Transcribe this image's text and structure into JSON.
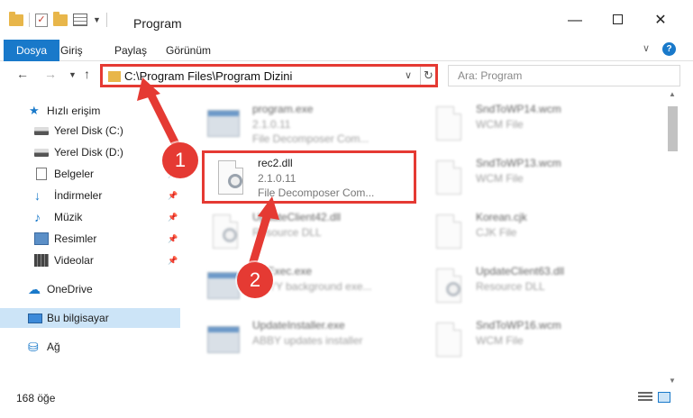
{
  "window": {
    "title": "Program"
  },
  "ribbon": {
    "tabs": [
      {
        "label": "Dosya",
        "active": true
      },
      {
        "label": "Giriş"
      },
      {
        "label": "Paylaş"
      },
      {
        "label": "Görünüm"
      }
    ]
  },
  "address": {
    "path": "C:\\Program Files\\Program Dizini"
  },
  "search": {
    "placeholder": "Ara: Program"
  },
  "sidebar": {
    "items": [
      {
        "label": "Hızlı erişim",
        "icon": "star-icon"
      },
      {
        "label": "Yerel Disk (C:)",
        "icon": "disk-icon"
      },
      {
        "label": "Yerel Disk (D:)",
        "icon": "disk-icon"
      },
      {
        "label": "Belgeler",
        "icon": "documents-icon",
        "pinned": true
      },
      {
        "label": "İndirmeler",
        "icon": "downloads-icon",
        "pinned": true
      },
      {
        "label": "Müzik",
        "icon": "music-icon",
        "pinned": true
      },
      {
        "label": "Resimler",
        "icon": "pictures-icon",
        "pinned": true
      },
      {
        "label": "Videolar",
        "icon": "videos-icon",
        "pinned": true
      },
      {
        "label": "OneDrive",
        "icon": "onedrive-icon"
      },
      {
        "label": "Bu bilgisayar",
        "icon": "computer-icon",
        "selected": true
      },
      {
        "label": "Ağ",
        "icon": "network-icon"
      }
    ]
  },
  "files": [
    {
      "name": "program.exe",
      "line2": "2.1.0.11",
      "line3": "File Decomposer Com...",
      "icon": "exe-icon"
    },
    {
      "name": "SndToWP14.wcm",
      "line2": "WCM File",
      "line3": "",
      "icon": "document-icon"
    },
    {
      "name": "rec2.dll",
      "line2": "2.1.0.11",
      "line3": "File Decomposer Com...",
      "icon": "dll-icon"
    },
    {
      "name": "SndToWP13.wcm",
      "line2": "WCM File",
      "line3": "",
      "icon": "document-icon"
    },
    {
      "name": "UpdateClient42.dll",
      "line2": "Resource DLL",
      "line3": "",
      "icon": "dll-icon"
    },
    {
      "name": "Korean.cjk",
      "line2": "CJK File",
      "line3": "",
      "icon": "document-icon"
    },
    {
      "name": "...eExec.exe",
      "line2": "...BYY background exe...",
      "line3": "",
      "icon": "exe-icon"
    },
    {
      "name": "UpdateClient63.dll",
      "line2": "Resource DLL",
      "line3": "",
      "icon": "dll-icon"
    },
    {
      "name": "UpdateInstaller.exe",
      "line2": "ABBY updates installer",
      "line3": "",
      "icon": "exe-icon"
    },
    {
      "name": "SndToWP16.wcm",
      "line2": "WCM File",
      "line3": "",
      "icon": "document-icon"
    }
  ],
  "annotations": {
    "step1": "1",
    "step2": "2",
    "color": "#e53a33"
  },
  "status": {
    "count": "168 öğe"
  },
  "colors": {
    "accent": "#1979ca",
    "highlight": "#e53a33"
  }
}
